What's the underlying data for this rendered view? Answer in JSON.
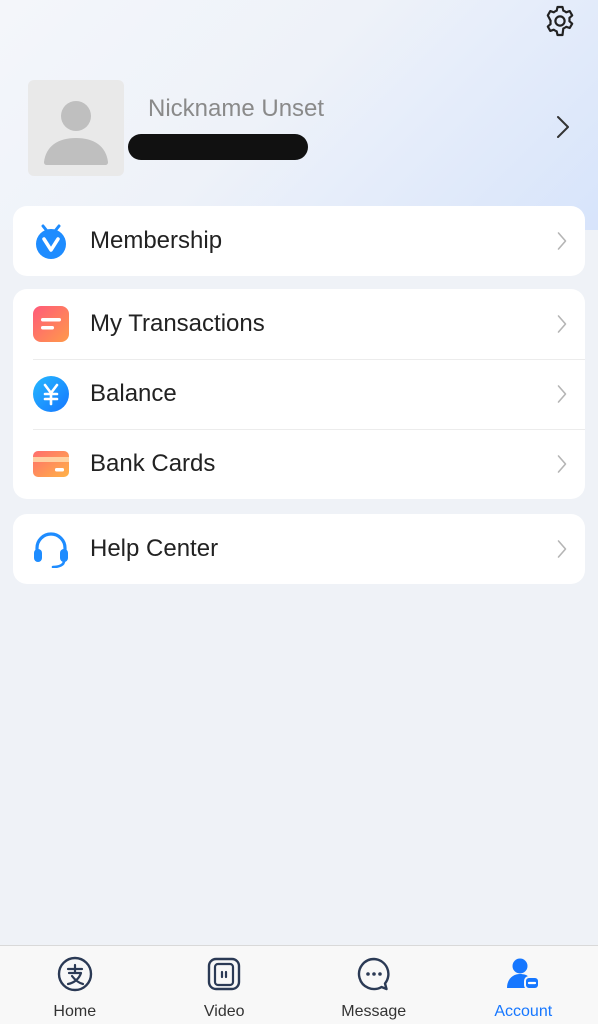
{
  "profile": {
    "nickname": "Nickname Unset"
  },
  "menu": {
    "membership": "Membership",
    "transactions": "My Transactions",
    "balance": "Balance",
    "bank_cards": "Bank Cards",
    "help_center": "Help Center"
  },
  "tabs": {
    "home": "Home",
    "video": "Video",
    "message": "Message",
    "account": "Account"
  },
  "icons": {
    "settings": "gear-icon",
    "membership": "membership-badge-icon",
    "transactions": "transactions-icon",
    "balance": "yuan-coin-icon",
    "bank_cards": "bank-card-icon",
    "help_center": "headset-icon",
    "home": "alipay-icon",
    "video": "video-icon",
    "message": "message-bubble-icon",
    "account": "account-icon"
  },
  "colors": {
    "accent": "#1677ff",
    "background": "#eff2f7",
    "card": "#ffffff"
  }
}
